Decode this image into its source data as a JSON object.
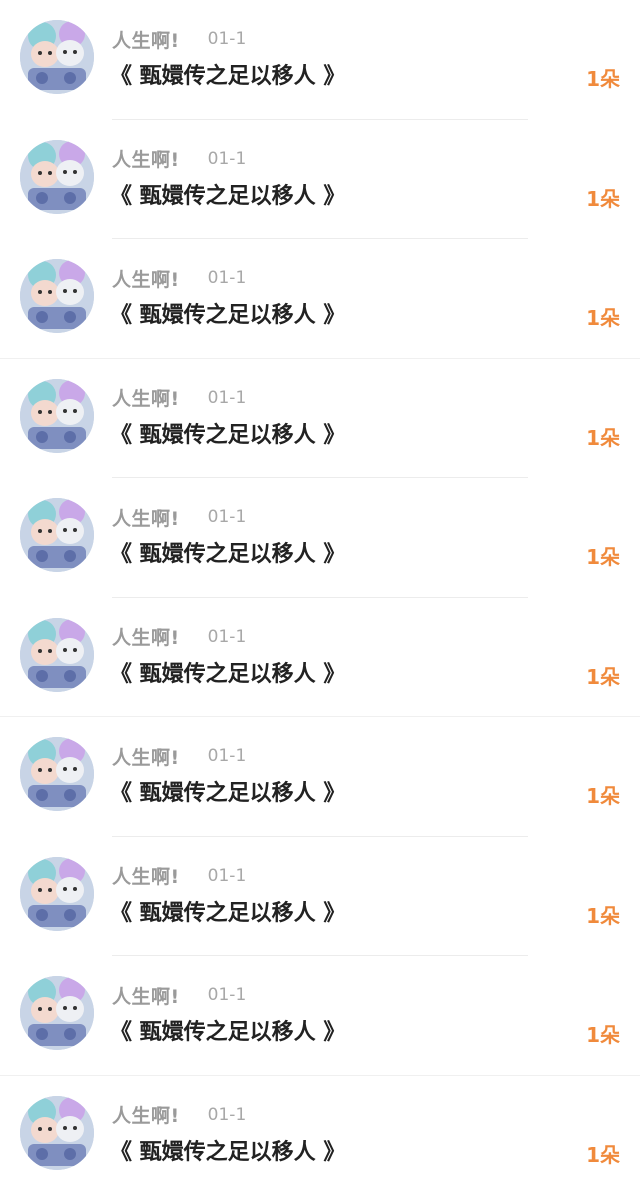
{
  "items": [
    {
      "username": "人生啊!",
      "date": "01-1",
      "title": "《 甄嬛传之足以移人 》",
      "gift": "1朵",
      "avatar_icon": "user-avatar"
    },
    {
      "username": "人生啊!",
      "date": "01-1",
      "title": "《 甄嬛传之足以移人 》",
      "gift": "1朵",
      "avatar_icon": "user-avatar"
    },
    {
      "username": "人生啊!",
      "date": "01-1",
      "title": "《 甄嬛传之足以移人 》",
      "gift": "1朵",
      "avatar_icon": "user-avatar"
    },
    {
      "username": "人生啊!",
      "date": "01-1",
      "title": "《 甄嬛传之足以移人 》",
      "gift": "1朵",
      "avatar_icon": "user-avatar"
    },
    {
      "username": "人生啊!",
      "date": "01-1",
      "title": "《 甄嬛传之足以移人 》",
      "gift": "1朵",
      "avatar_icon": "user-avatar"
    },
    {
      "username": "人生啊!",
      "date": "01-1",
      "title": "《 甄嬛传之足以移人 》",
      "gift": "1朵",
      "avatar_icon": "user-avatar"
    },
    {
      "username": "人生啊!",
      "date": "01-1",
      "title": "《 甄嬛传之足以移人 》",
      "gift": "1朵",
      "avatar_icon": "user-avatar"
    },
    {
      "username": "人生啊!",
      "date": "01-1",
      "title": "《 甄嬛传之足以移人 》",
      "gift": "1朵",
      "avatar_icon": "user-avatar"
    },
    {
      "username": "人生啊!",
      "date": "01-1",
      "title": "《 甄嬛传之足以移人 》",
      "gift": "1朵",
      "avatar_icon": "user-avatar"
    },
    {
      "username": "人生啊!",
      "date": "01-1",
      "title": "《 甄嬛传之足以移人 》",
      "gift": "1朵",
      "avatar_icon": "user-avatar"
    }
  ],
  "colors": {
    "gift": "#f08a3c",
    "title": "#222222",
    "username": "#9a9a9a",
    "date": "#a8a8a8",
    "divider": "#ececec"
  }
}
